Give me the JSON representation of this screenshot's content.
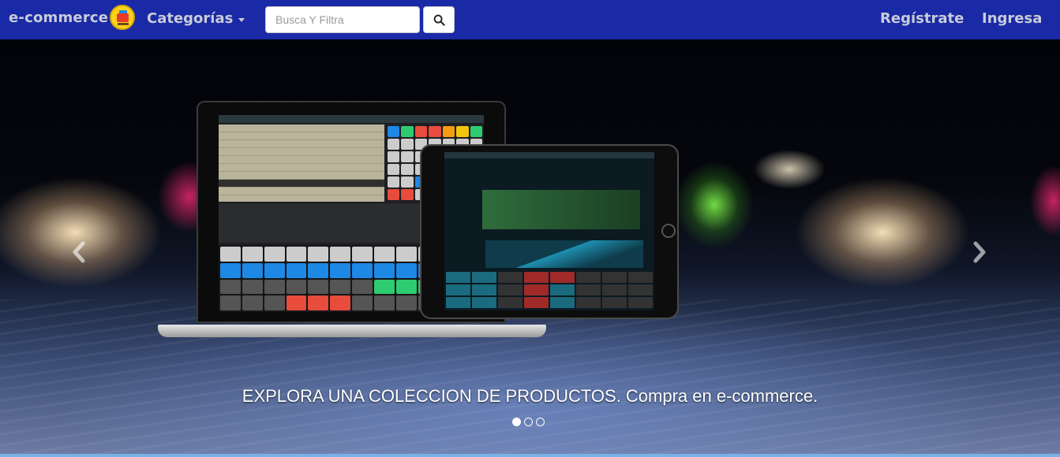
{
  "navbar": {
    "brand": "e-commerce",
    "logo_icon": "cart-computer-logo-icon",
    "categories_label": "Categorías",
    "search": {
      "placeholder": "Busca Y Filtra",
      "value": ""
    },
    "search_icon": "search-icon",
    "register_label": "Regístrate",
    "login_label": "Ingresa",
    "colors": {
      "background": "#1a2aa6",
      "text": "#c9ccd8"
    }
  },
  "carousel": {
    "caption": "EXPLORA UNA COLECCION DE PRODUCTOS. Compra en e-commerce.",
    "prev_icon": "chevron-left-icon",
    "next_icon": "chevron-right-icon",
    "slides_total": 3,
    "active_slide": 1
  }
}
